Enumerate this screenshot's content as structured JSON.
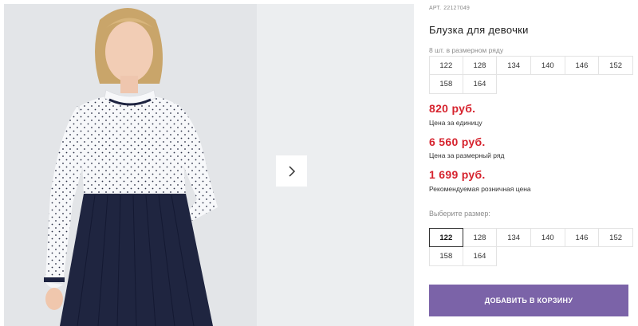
{
  "product": {
    "art_label": "АРТ.",
    "art_number": "22127049",
    "title": "Блузка для девочки",
    "row_count": "8 шт. в размерном ряду"
  },
  "size_row": [
    "122",
    "128",
    "134",
    "140",
    "146",
    "152",
    "158",
    "164"
  ],
  "prices": [
    {
      "value": "820 руб.",
      "note": "Цена за единицу"
    },
    {
      "value": "6 560 руб.",
      "note": "Цена за размерный ряд"
    },
    {
      "value": "1 699 руб.",
      "note": "Рекомендуемая розничная цена"
    }
  ],
  "size_select": {
    "label": "Выберите размер:",
    "options": [
      "122",
      "128",
      "134",
      "140",
      "146",
      "152",
      "158",
      "164"
    ],
    "selected": "122"
  },
  "cart_button": "ДОБАВИТЬ В КОРЗИНУ",
  "gallery": {
    "next_icon": "chevron-right-icon"
  },
  "colors": {
    "price": "#d6232e",
    "accent": "#7b63a8"
  }
}
